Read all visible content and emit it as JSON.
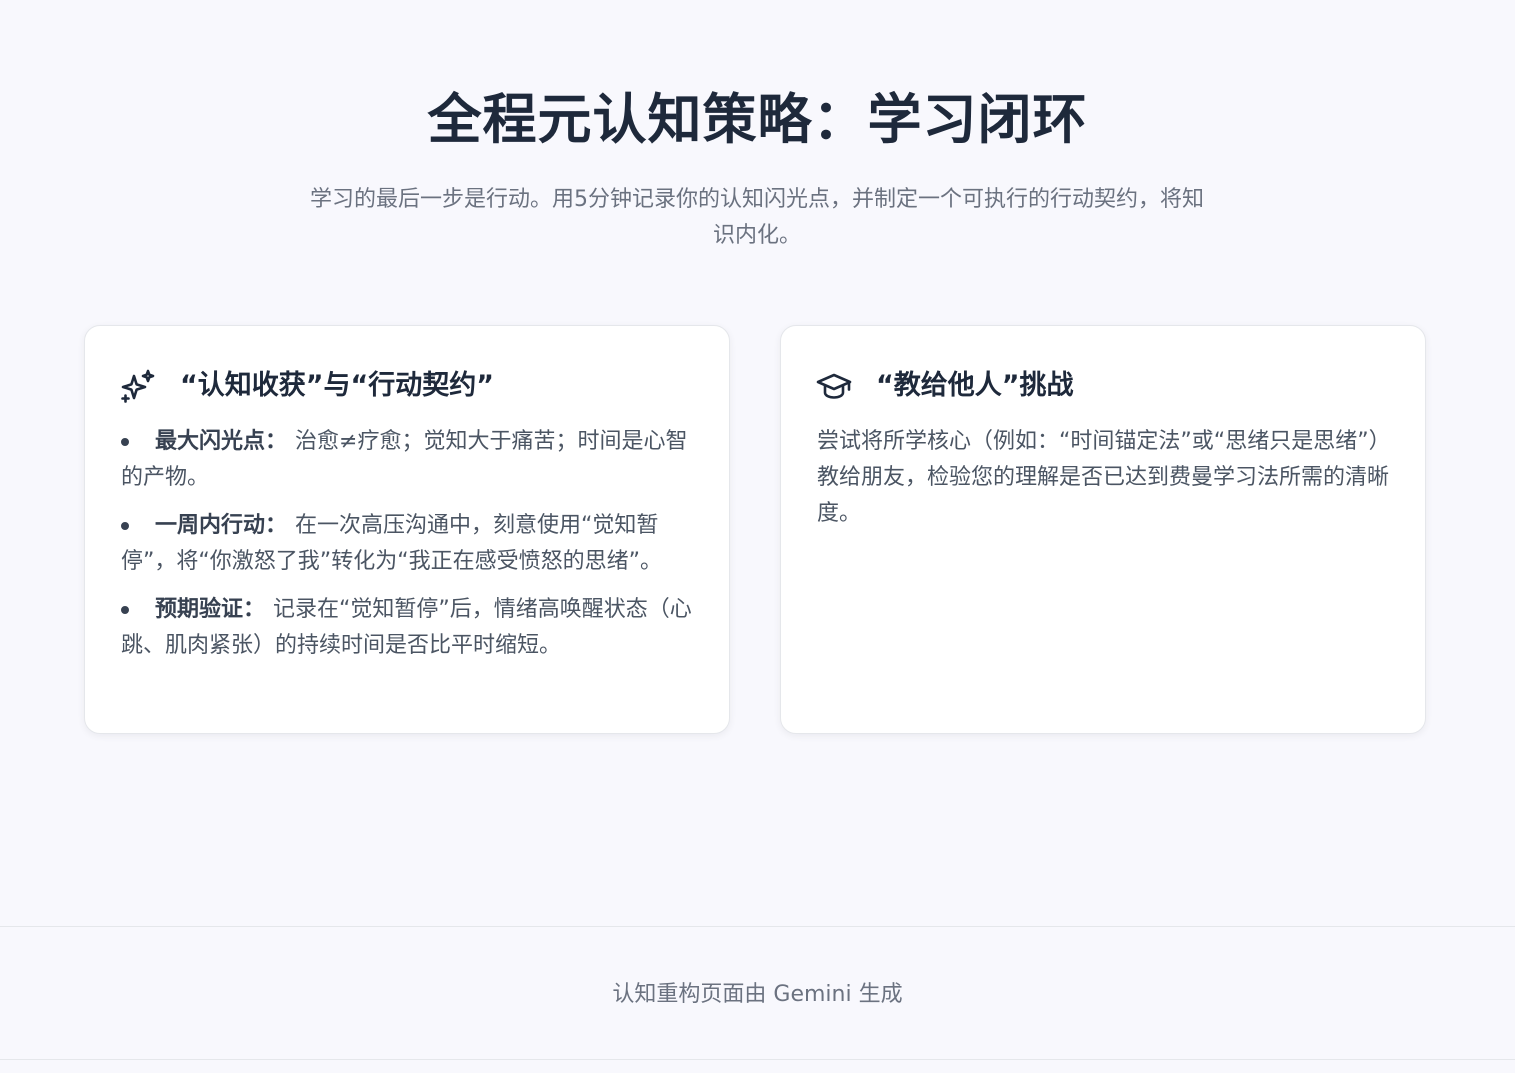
{
  "header": {
    "title": "全程元认知策略：学习闭环",
    "subtitle": "学习的最后一步是行动。用5分钟记录你的认知闪光点，并制定一个可执行的行动契约，将知识内化。"
  },
  "cards": [
    {
      "icon": "sparkles-icon",
      "title": "“认知收获”与“行动契约”",
      "points": [
        {
          "label": "最大闪光点：",
          "text": "治愈≠疗愈；觉知大于痛苦；时间是心智的产物。"
        },
        {
          "label": "一周内行动：",
          "text": "在一次高压沟通中，刻意使用“觉知暂停”，将“你激怒了我”转化为“我正在感受愤怒的思绪”。"
        },
        {
          "label": "预期验证：",
          "text": "记录在“觉知暂停”后，情绪高唤醒状态（心跳、肌肉紧张）的持续时间是否比平时缩短。"
        }
      ]
    },
    {
      "icon": "graduation-cap-icon",
      "title": "“教给他人”挑战",
      "text": "尝试将所学核心（例如：“时间锚定法”或“思绪只是思绪”）教给朋友，检验您的理解是否已达到费曼学习法所需的清晰度。"
    }
  ],
  "footer": {
    "text": "认知重构页面由 Gemini 生成"
  }
}
